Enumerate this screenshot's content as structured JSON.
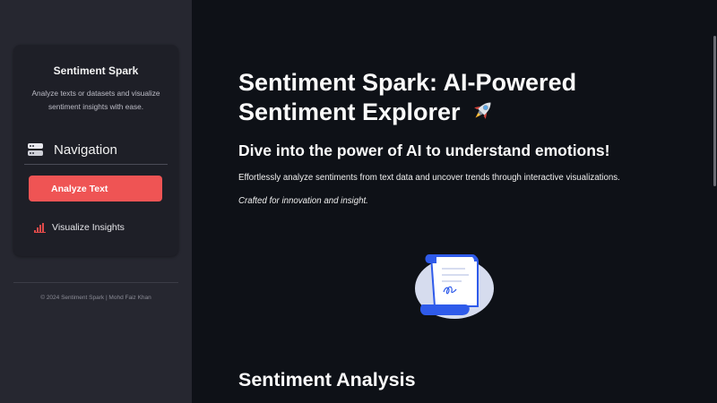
{
  "sidebar": {
    "title": "Sentiment Spark",
    "description": "Analyze texts or datasets and visualize sentiment insights with ease.",
    "nav_heading": "Navigation",
    "nav_heading_icon": "server-icon",
    "items": [
      {
        "label": "Analyze Text",
        "active": true
      },
      {
        "label": "Visualize Insights",
        "icon": "bar-chart-icon",
        "active": false
      }
    ],
    "footer": "© 2024 Sentiment Spark | Mohd Faiz Khan"
  },
  "main": {
    "title": "Sentiment Spark: AI-Powered Sentiment Explorer",
    "title_icon": "rocket-icon",
    "subtitle": "Dive into the power of AI to understand emotions!",
    "description": "Effortlessly analyze sentiments from text data and uncover trends through interactive visualizations.",
    "tagline": "Crafted for innovation and insight.",
    "illustration": "document-scroll-illustration",
    "section_title": "Sentiment Analysis"
  },
  "colors": {
    "background": "#0e1117",
    "sidebar": "#262730",
    "primary_button": "#ef5454",
    "text": "#fafafa",
    "illustration_blue": "#2f5bea"
  }
}
